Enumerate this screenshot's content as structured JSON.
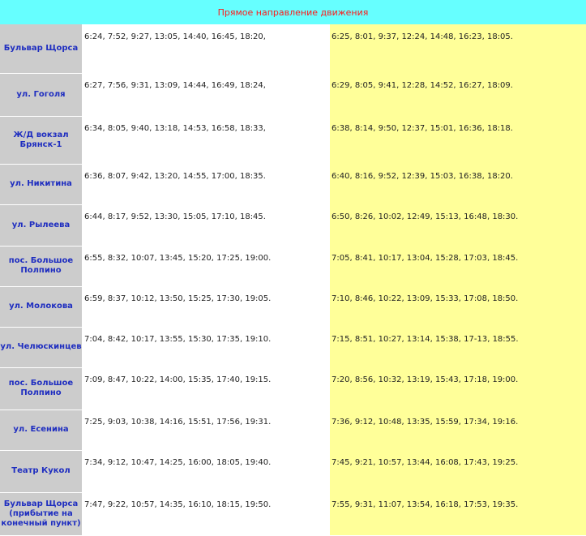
{
  "title": "Прямое направление движения",
  "rows": [
    {
      "stop": "Бульвар Щорса",
      "weekday": "6:24, 7:52, 9:27, 13:05, 14:40, 16:45, 18:20,",
      "weekend": "6:25, 8:01, 9:37, 12:24, 14:48, 16:23, 18:05."
    },
    {
      "stop": "ул. Гоголя",
      "weekday": "6:27, 7:56, 9:31, 13:09, 14:44, 16:49, 18:24,",
      "weekend": "6:29, 8:05, 9:41, 12:28, 14:52, 16:27, 18:09."
    },
    {
      "stop": "Ж/Д вокзал Брянск-1",
      "weekday": "6:34, 8:05, 9:40, 13:18, 14:53, 16:58, 18:33,",
      "weekend": "6:38, 8:14, 9:50, 12:37, 15:01, 16:36, 18:18."
    },
    {
      "stop": "ул. Никитина",
      "weekday": "6:36, 8:07, 9:42, 13:20, 14:55, 17:00, 18:35.",
      "weekend": "6:40, 8:16, 9:52, 12:39, 15:03, 16:38, 18:20."
    },
    {
      "stop": "ул. Рылеева",
      "weekday": "6:44, 8:17, 9:52, 13:30, 15:05, 17:10, 18:45.",
      "weekend": "6:50, 8:26, 10:02, 12:49, 15:13, 16:48, 18:30."
    },
    {
      "stop": "пос. Большое Полпино",
      "weekday": "6:55, 8:32, 10:07, 13:45, 15:20, 17:25, 19:00.",
      "weekend": "7:05, 8:41, 10:17, 13:04, 15:28, 17:03, 18:45."
    },
    {
      "stop": "ул. Молокова",
      "weekday": "6:59, 8:37, 10:12, 13:50, 15:25, 17:30, 19:05.",
      "weekend": "7:10, 8:46, 10:22, 13:09, 15:33, 17:08, 18:50."
    },
    {
      "stop": "ул. Челюскинцев",
      "weekday": "7:04, 8:42, 10:17, 13:55, 15:30, 17:35, 19:10.",
      "weekend": "7:15, 8:51, 10:27, 13:14, 15:38, 17-13, 18:55."
    },
    {
      "stop": "пос. Большое Полпино",
      "weekday": "7:09, 8:47, 10:22, 14:00, 15:35, 17:40, 19:15.",
      "weekend": "7:20, 8:56, 10:32, 13:19, 15:43, 17:18, 19:00."
    },
    {
      "stop": "ул. Есенина",
      "weekday": "7:25, 9:03, 10:38, 14:16, 15:51, 17:56, 19:31.",
      "weekend": "7:36, 9:12, 10:48, 13:35, 15:59, 17:34, 19:16."
    },
    {
      "stop": "Театр Кукол",
      "weekday": "7:34, 9:12, 10:47, 14:25, 16:00, 18:05, 19:40.",
      "weekend": "7:45, 9:21, 10:57, 13:44, 16:08, 17:43, 19:25."
    },
    {
      "stop": "Бульвар Щорса (прибытие на конечный пункт)",
      "weekday": "7:47, 9:22, 10:57, 14:35, 16:10, 18:15, 19:50.",
      "weekend": "7:55, 9:31, 11:07, 13:54, 16:18, 17:53, 19:35."
    }
  ]
}
